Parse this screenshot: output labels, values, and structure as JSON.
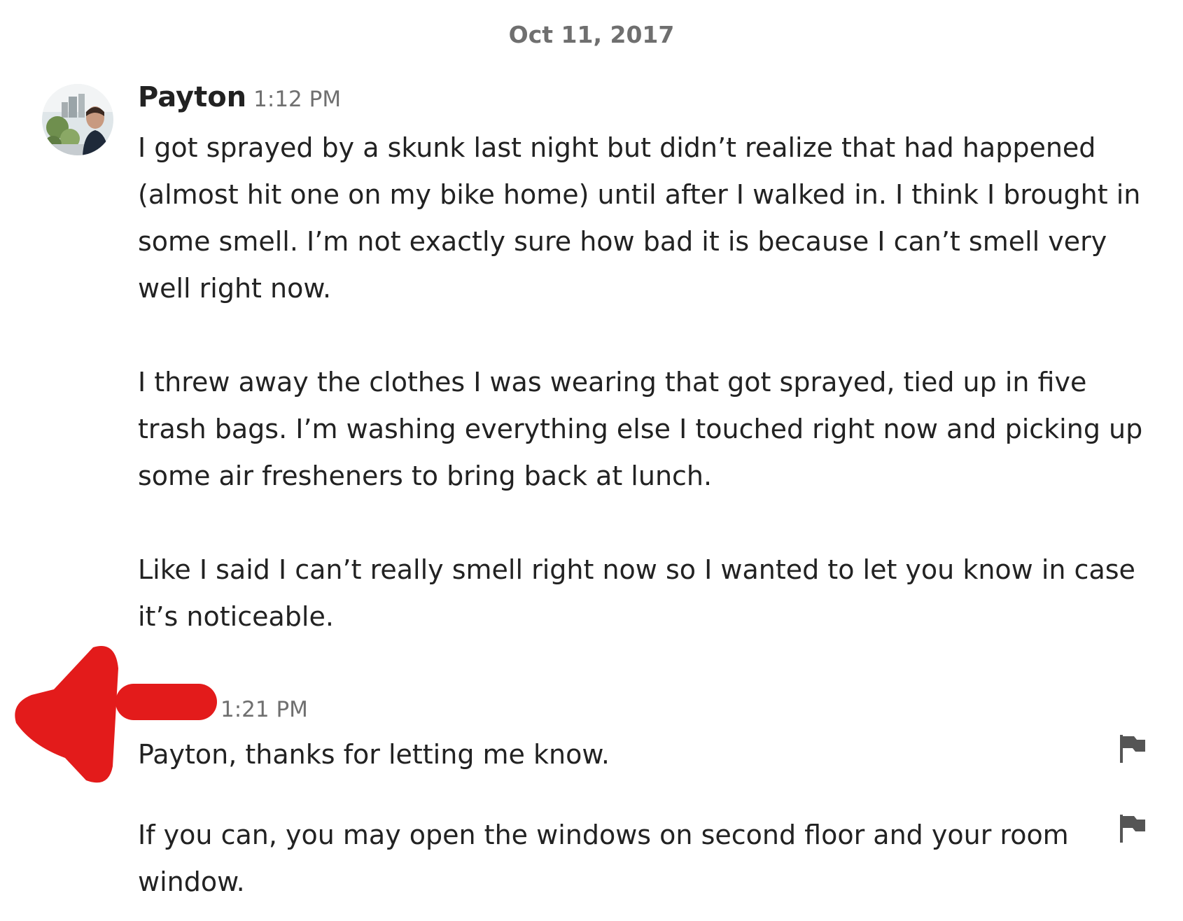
{
  "date_divider": "Oct 11, 2017",
  "messages": [
    {
      "sender": "Payton",
      "time": "1:12 PM",
      "paragraphs": [
        "I got sprayed by a skunk last night but didn’t realize that had happened (almost hit one on my bike home) until after I walked in. I think I brought in some smell. I’m not exactly sure how bad it is because I can’t smell very well right now.",
        "I threw away the clothes I was wearing that got sprayed, tied up in five trash bags. I’m washing everything else I touched right now and picking up some air fresheners to bring back at lunch.",
        "Like I said I can’t really smell right now so I wanted to let you know in case it’s noticeable."
      ]
    },
    {
      "sender": "",
      "time": "1:21 PM",
      "paragraphs": [
        "Payton, thanks for letting me know.",
        "If you can, you may open the windows on second floor and your room window."
      ]
    }
  ],
  "icons": {
    "flag": "flag-icon",
    "avatar": "avatar-photo"
  },
  "colors": {
    "text": "#222222",
    "muted": "#6f6f6f",
    "redaction": "#e31b1b"
  }
}
